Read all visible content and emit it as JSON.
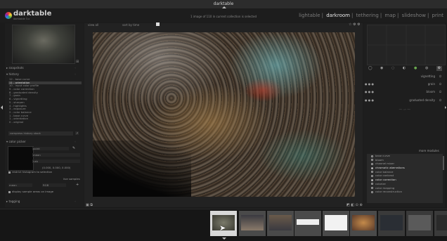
{
  "window": {
    "title": "darktable"
  },
  "app": {
    "brand": "darktable",
    "brand_sub": "darktable 3.x"
  },
  "header": {
    "selection_info": "1 image of 110 in current collection is selected",
    "views": [
      {
        "label": "lightable",
        "active": false
      },
      {
        "label": "darkroom",
        "active": true
      },
      {
        "label": "tethering",
        "active": false
      },
      {
        "label": "map",
        "active": false
      },
      {
        "label": "slideshow",
        "active": false
      },
      {
        "label": "print",
        "active": false
      }
    ],
    "view_label": "view",
    "view_value": "all",
    "sort_label": "sort by",
    "sort_value": "time"
  },
  "left": {
    "snapshots_title": "snapshots",
    "history_title": "history",
    "history_items": [
      "12 - base curve",
      "11 - orientation",
      "10 - input color profile",
      "9 - color correction",
      "8 - graduated density",
      "7 - grain",
      "6 - vignetting",
      "5 - sharpen",
      "4 - highlights",
      "3 - exposure",
      "2 - color balance",
      "1 - base curve",
      "1 - orientation",
      "0 - original"
    ],
    "history_selected": 1,
    "compress_label": "compress history stack",
    "color_picker_title": "color picker",
    "picker_mode": "point",
    "picker_stat": "mean",
    "picker_space": "Lab",
    "picker_values": "(0.000, 0.000, 0.000)",
    "restrict_label": "restrict histogram to selection",
    "live_samples_label": "live samples",
    "sample_stat": "mean",
    "sample_space": "RGB",
    "display_samples_label": "display sample areas on image",
    "tagging_title": "tagging"
  },
  "right": {
    "module_tabs": [
      "power-icon",
      "circle-icon",
      "base-icon",
      "tone-icon",
      "color-icon",
      "correct-icon",
      "effect-icon"
    ],
    "modules": [
      {
        "label": "vignetting"
      },
      {
        "label": "grain"
      },
      {
        "label": "bloom"
      },
      {
        "label": "graduated density"
      }
    ],
    "more_modules_label": "more modules",
    "more_modules": [
      {
        "label": "base curve",
        "on": false
      },
      {
        "label": "bloom",
        "on": false
      },
      {
        "label": "channel mixer",
        "on": false
      },
      {
        "label": "chromatic aberrations",
        "on": true
      },
      {
        "label": "color balance",
        "on": false
      },
      {
        "label": "color contrast",
        "on": false
      },
      {
        "label": "color correction",
        "on": true
      },
      {
        "label": "colorize",
        "on": false
      },
      {
        "label": "color mapping",
        "on": false
      },
      {
        "label": "color reconstruction",
        "on": false
      }
    ]
  },
  "colors": {
    "accent": "#dcdcdc",
    "bg": "#1b1b1b",
    "panel": "#1e1e1e"
  }
}
